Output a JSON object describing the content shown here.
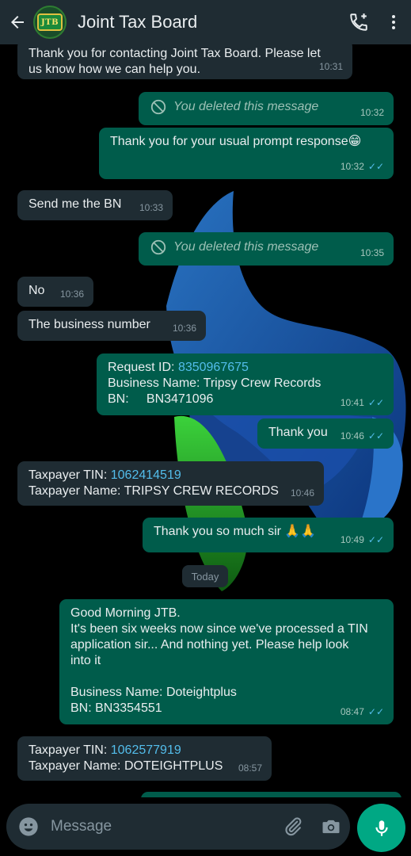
{
  "header": {
    "title": "Joint Tax Board",
    "logo_text": "JTB"
  },
  "messages": {
    "m0": {
      "text": "Thank you for contacting Joint Tax Board. Please let",
      "text2": "us know how we can help you.",
      "time": "10:31"
    },
    "m1": {
      "text": "You deleted this message",
      "time": "10:32"
    },
    "m2": {
      "text": "Thank you for your usual prompt response😁",
      "time": "10:32"
    },
    "m3": {
      "text": "Send me the BN",
      "time": "10:33"
    },
    "m4": {
      "text": "You deleted this message",
      "time": "10:35"
    },
    "m5": {
      "text": "No",
      "time": "10:36"
    },
    "m6": {
      "text": "The business number",
      "time": "10:36"
    },
    "m7": {
      "label1": "Request ID: ",
      "link1": "8350967675",
      "line2": "Business Name: Tripsy Crew Records",
      "line3": "BN:     BN3471096",
      "time": "10:41"
    },
    "m8": {
      "text": "Thank you",
      "time": "10:46"
    },
    "m9": {
      "label1": "Taxpayer TIN: ",
      "link1": "1062414519",
      "line2": "Taxpayer Name: TRIPSY CREW RECORDS",
      "time": "10:46"
    },
    "m10": {
      "text": "Thank you so much sir 🙏🙏",
      "time": "10:49"
    },
    "m11": {
      "line1": "Good Morning JTB.",
      "line2": "It's been six weeks now since we've processed a TIN",
      "line3": "application sir... And nothing yet. Please help look",
      "line4": "into it",
      "line5": "Business Name: Doteightplus",
      "line6": "BN: BN3354551",
      "time": "08:47"
    },
    "m12": {
      "label1": "Taxpayer TIN: ",
      "link1": "1062577919",
      "line2": "Taxpayer Name: DOTEIGHTPLUS",
      "time": "08:57"
    }
  },
  "date_divider": "Today",
  "composer": {
    "placeholder": "Message"
  },
  "colors": {
    "header_bg": "#1f2c33",
    "incoming_bubble": "#1f2c33",
    "outgoing_bubble": "#005c4b",
    "read_ticks": "#53bdeb",
    "mic_button": "#00a884"
  },
  "icons": {
    "back": "arrow-left-icon",
    "add_call": "phone-plus-icon",
    "menu": "more-vertical-icon",
    "emoji": "emoji-icon",
    "attach": "paperclip-icon",
    "camera": "camera-icon",
    "mic": "microphone-icon",
    "deleted": "blocked-icon",
    "read": "double-check-icon"
  }
}
